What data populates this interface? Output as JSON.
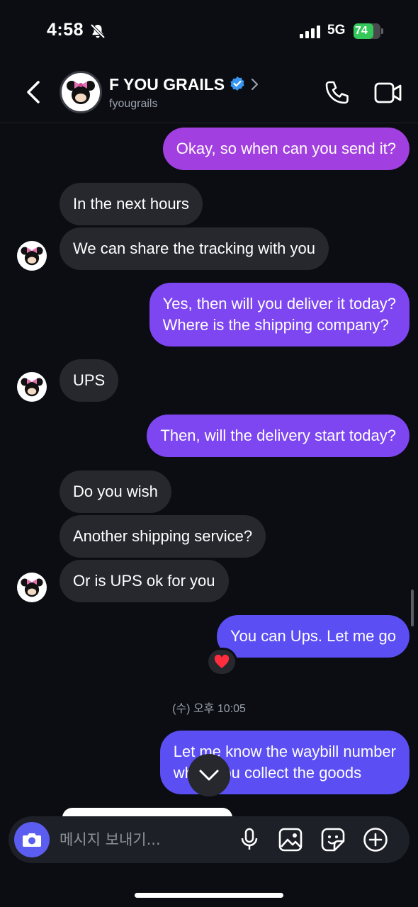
{
  "status_bar": {
    "time": "4:58",
    "network": "5G",
    "battery_percent": 74,
    "battery_label": "74"
  },
  "header": {
    "name": "F YOU GRAILS",
    "handle": "fyougrails",
    "verified": true
  },
  "messages": [
    {
      "side": "out",
      "text": "Okay, so when can you send it?"
    },
    {
      "side": "in",
      "text": "In the next hours"
    },
    {
      "side": "in",
      "text": "We can share the tracking with you"
    },
    {
      "side": "out",
      "text": "Yes, then will you deliver it today?\nWhere is the shipping company?"
    },
    {
      "side": "in",
      "text": "UPS"
    },
    {
      "side": "out",
      "text": "Then, will the delivery start today?"
    },
    {
      "side": "in",
      "text": "Do you wish"
    },
    {
      "side": "in",
      "text": "Another shipping service?"
    },
    {
      "side": "in",
      "text": "Or is UPS ok for you"
    },
    {
      "side": "out",
      "text": "You can Ups. Let me go",
      "reaction": "❤️"
    },
    {
      "side": "out",
      "text": "Let me know the waybill number\nwhen you collect the goods"
    }
  ],
  "timestamp": "(수) 오후 10:05",
  "composer": {
    "placeholder": "메시지 보내기..."
  },
  "colors": {
    "background": "#0b0d12",
    "incoming_bubble": "#26282e",
    "outgoing_bubble_top": "#a23fe0",
    "outgoing_bubble_mid": "#7d46f0",
    "outgoing_bubble_bottom": "#5b4ef3",
    "verified": "#3897f0",
    "battery": "#34c759"
  },
  "icons": [
    "mute-bell-icon",
    "signal-icon",
    "back-arrow-icon",
    "verified-badge-icon",
    "chevron-right-icon",
    "phone-icon",
    "video-camera-icon",
    "heart-icon",
    "chevron-down-icon",
    "camera-icon",
    "microphone-icon",
    "image-icon",
    "sticker-icon",
    "plus-circle-icon"
  ]
}
